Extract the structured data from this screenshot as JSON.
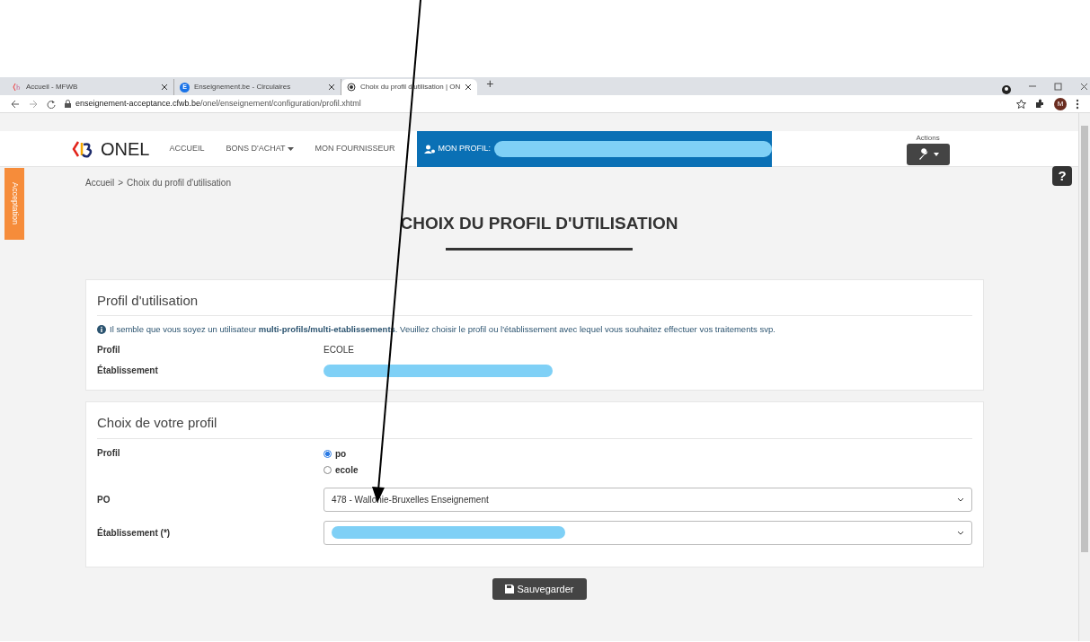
{
  "browser": {
    "tabs": [
      {
        "title": "Accueil - MFWB",
        "selected": false,
        "kind": "logo"
      },
      {
        "title": "Enseignement.be - Circulaires",
        "selected": false,
        "kind": "letter",
        "icon_letter": "E"
      },
      {
        "title": "Choix du profil d'utilisation | ON",
        "selected": true,
        "kind": "globe"
      }
    ],
    "new_tab": "+",
    "url_host": "enseignement-acceptance.cfwb.be",
    "url_path": "/onel/enseignement/configuration/profil.xhtml",
    "avatar": "M"
  },
  "header": {
    "brand": "ONEL",
    "nav": [
      {
        "label": "ACCUEIL",
        "dropdown": false
      },
      {
        "label": "BONS D'ACHAT",
        "dropdown": true
      },
      {
        "label": "MON FOURNISSEUR",
        "dropdown": false
      }
    ],
    "profile_label": "MON PROFIL:",
    "actions_label": "Actions"
  },
  "env_tab": "Acceptation",
  "breadcrumb": [
    "Accueil",
    "Choix du profil d'utilisation"
  ],
  "breadcrumb_separator": ">",
  "page_title": "CHOIX DU PROFIL D'UTILISATION",
  "help": "?",
  "current_profile": {
    "title": "Profil d'utilisation",
    "notice": "Il semble que vous soyez un utilisateur **multi-profils/multi-etablissements**. Veuillez choisir le profil ou l'établissement avec lequel vous souhaitez effectuer vos traitements svp.",
    "fields": [
      {
        "label": "Profil",
        "value": "ECOLE",
        "redacted": false
      },
      {
        "label": "Établissement",
        "redacted": true
      }
    ]
  },
  "choice": {
    "title": "Choix de votre profil",
    "profile_label": "Profil",
    "options": [
      {
        "label": "po",
        "selected": true
      },
      {
        "label": "ecole",
        "selected": false
      }
    ],
    "selects": [
      {
        "label": "PO",
        "value": "478 - Wallonie-Bruxelles Enseignement",
        "redacted": false
      },
      {
        "label": "Établissement (*)",
        "redacted": true
      }
    ]
  },
  "save_button": "Sauvegarder"
}
